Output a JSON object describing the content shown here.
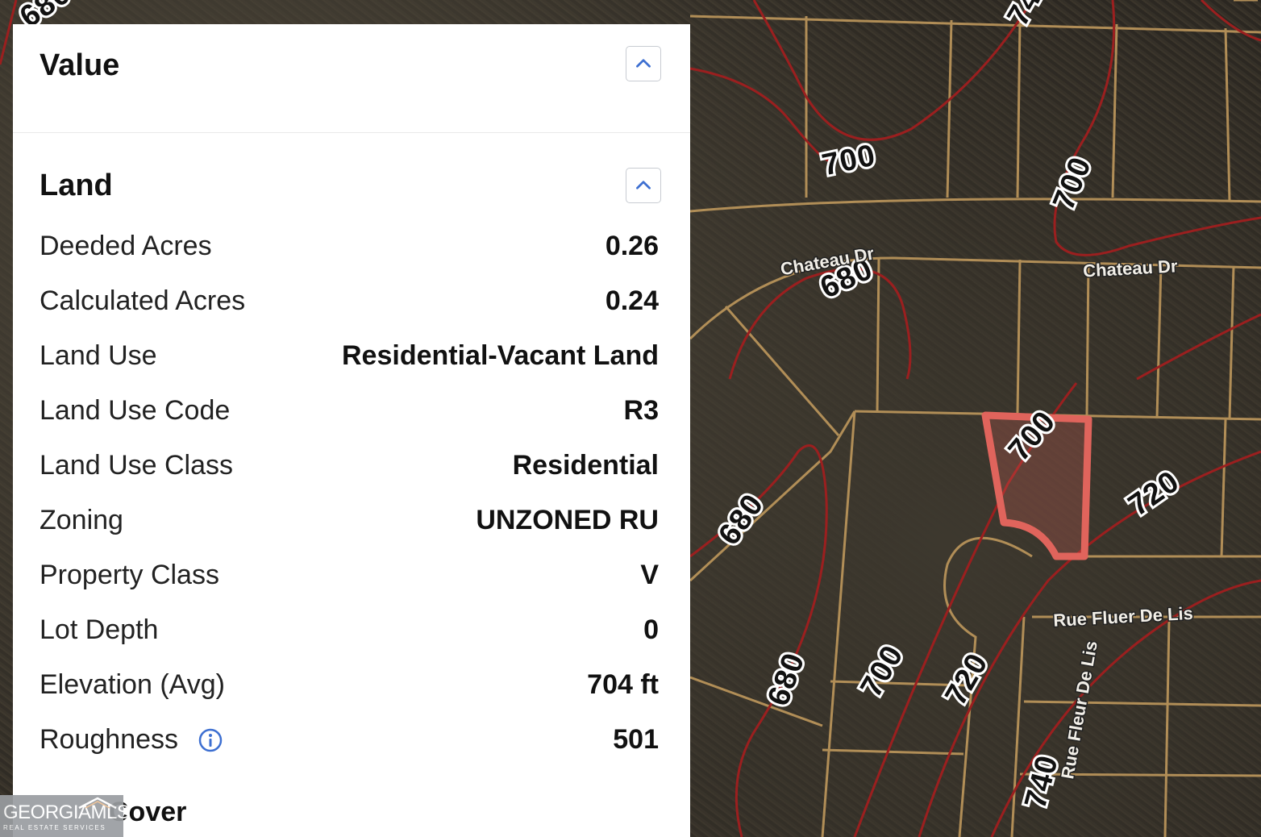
{
  "sections": {
    "value": {
      "title": "Value",
      "collapse_label": "collapse"
    },
    "land": {
      "title": "Land",
      "rows": [
        {
          "label": "Deeded Acres",
          "value": "0.26"
        },
        {
          "label": "Calculated Acres",
          "value": "0.24"
        },
        {
          "label": "Land Use",
          "value": "Residential-Vacant Land"
        },
        {
          "label": "Land Use Code",
          "value": "R3"
        },
        {
          "label": "Land Use Class",
          "value": "Residential"
        },
        {
          "label": "Zoning",
          "value": "UNZONED RU"
        },
        {
          "label": "Property Class",
          "value": "V"
        },
        {
          "label": "Lot Depth",
          "value": "0"
        },
        {
          "label": "Elevation (Avg)",
          "value": "704 ft"
        },
        {
          "label": "Roughness",
          "value": "501"
        }
      ]
    },
    "next": {
      "title_visible": "Cover"
    }
  },
  "map": {
    "contour_labels": [
      "700",
      "700",
      "680",
      "680",
      "700",
      "720",
      "680",
      "680",
      "700",
      "720",
      "740",
      "740"
    ],
    "street_labels": [
      "Chateau Dr",
      "Chateau Dr",
      "Rue Fluer De Lis",
      "Rue Fleur De Lis"
    ],
    "colors": {
      "contour": "#9b1f1f",
      "parcel_line": "#b8935a",
      "highlight_parcel": "#e0645c"
    }
  },
  "watermark": {
    "brand_left": "GEORGIA",
    "brand_right": "MLS",
    "tagline": "REAL ESTATE SERVICES"
  },
  "icons": {
    "collapse": "chevron-up-icon",
    "info": "info-icon"
  }
}
